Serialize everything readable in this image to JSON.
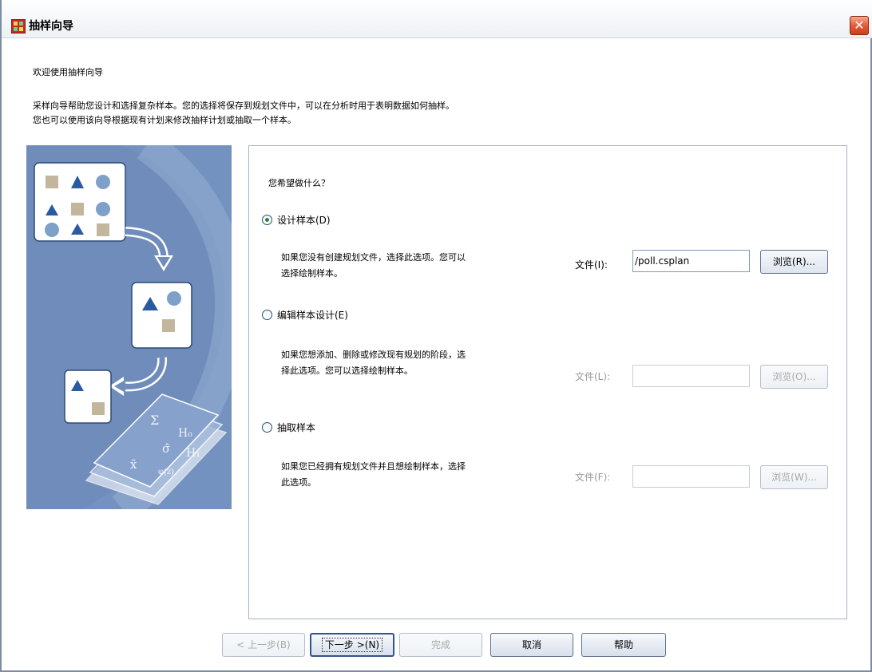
{
  "window": {
    "title": "抽样向导",
    "close": "✕"
  },
  "intro": {
    "welcome": "欢迎使用抽样向导",
    "desc_line1": "采样向导帮助您设计和选择复杂样本。您的选择将保存到规划文件中，可以在分析时用于表明数据如何抽样。",
    "desc_line2": "您也可以使用该向导根据现有计划来修改抽样计划或抽取一个样本。"
  },
  "panel": {
    "question": "您希望做什么？",
    "options": [
      {
        "label": "设计样本(D)",
        "selected": true,
        "description_line1": "如果您没有创建规划文件，选择此选项。您可以",
        "description_line2": "选择绘制样本。",
        "file_label": "文件(I):",
        "file_value": "/poll.csplan",
        "browse_label": "浏览(R)...",
        "enabled": true
      },
      {
        "label": "编辑样本设计(E)",
        "selected": false,
        "description_line1": "如果您想添加、删除或修改现有规划的阶段，选",
        "description_line2": "择此选项。您可以选择绘制样本。",
        "file_label": "文件(L):",
        "file_value": "",
        "browse_label": "浏览(O)...",
        "enabled": false
      },
      {
        "label": "抽取样本",
        "selected": false,
        "description_line1": "如果您已经拥有规划文件并且想绘制样本，选择",
        "description_line2": "此选项。",
        "file_label": "文件(F):",
        "file_value": "",
        "browse_label": "浏览(W)...",
        "enabled": false
      }
    ]
  },
  "footer": {
    "back": "< 上一步(B)",
    "next": "下一步 >(N)",
    "finish": "完成",
    "cancel": "取消",
    "help": "帮助"
  },
  "illustration": {
    "formula_symbols": [
      "Σ",
      "H₀",
      "σ̂",
      "H₁",
      "x̄",
      "φ(z)"
    ]
  },
  "colors": {
    "illustration_bg": "#6f8cbb",
    "shape_blue": "#2a5aa0",
    "shape_tan": "#c2b79c",
    "shape_light": "#7fa0c9"
  }
}
